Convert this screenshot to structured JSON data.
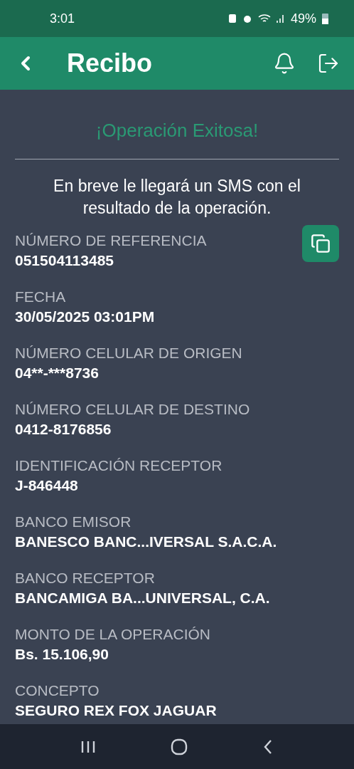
{
  "status_bar": {
    "time": "3:01",
    "battery": "49%"
  },
  "app_bar": {
    "title": "Recibo"
  },
  "success_title": "¡Operación Exitosa!",
  "message": "En breve le llegará un SMS con el resultado de la operación.",
  "fields": [
    {
      "label": "NÚMERO DE REFERENCIA",
      "value": "051504113485",
      "copyable": true
    },
    {
      "label": "FECHA",
      "value": "30/05/2025 03:01PM",
      "copyable": false
    },
    {
      "label": "NÚMERO CELULAR DE ORIGEN",
      "value": "04**-***8736",
      "copyable": false
    },
    {
      "label": "NÚMERO CELULAR DE DESTINO",
      "value": "0412-8176856",
      "copyable": false
    },
    {
      "label": "IDENTIFICACIÓN RECEPTOR",
      "value": "J-846448",
      "copyable": false
    },
    {
      "label": "BANCO EMISOR",
      "value": "BANESCO BANC...IVERSAL S.A.C.A.",
      "copyable": false
    },
    {
      "label": "BANCO RECEPTOR",
      "value": "BANCAMIGA BA...UNIVERSAL, C.A.",
      "copyable": false
    },
    {
      "label": "MONTO DE LA OPERACIÓN",
      "value": "Bs. 15.106,90",
      "copyable": false
    },
    {
      "label": "CONCEPTO",
      "value": "SEGURO REX FOX JAGUAR",
      "copyable": false
    }
  ]
}
